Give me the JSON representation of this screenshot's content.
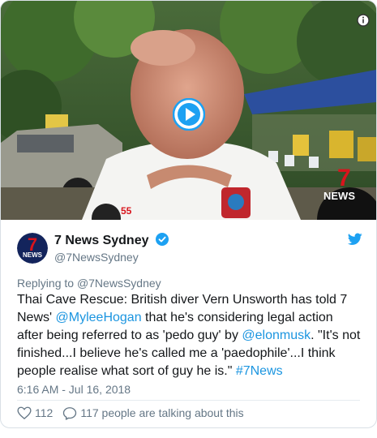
{
  "video": {
    "watermark_text": "NEWS",
    "shirt_text": "55",
    "badge_icon": "play-icon",
    "info_icon": "info-icon"
  },
  "account": {
    "display_name": "7 News Sydney",
    "handle": "@7NewsSydney",
    "avatar_text": "NEWS",
    "verified": true
  },
  "tweet": {
    "reply_prefix": "Replying to ",
    "reply_handle": "@7NewsSydney",
    "text_parts": [
      {
        "type": "text",
        "value": "Thai Cave Rescue: British diver Vern Unsworth has told 7 News' "
      },
      {
        "type": "link",
        "value": "@MyleeHogan"
      },
      {
        "type": "text",
        "value": " that he's considering legal action after being referred to as 'pedo guy' by "
      },
      {
        "type": "link",
        "value": "@elonmusk"
      },
      {
        "type": "text",
        "value": ". \"It's not finished...I believe he's called me a 'paedophile'...I think people realise what sort of guy he is.\" "
      },
      {
        "type": "link",
        "value": "#7News"
      }
    ],
    "timestamp": "6:16 AM - Jul 16, 2018",
    "likes": "112",
    "talking": "117 people are talking about this"
  },
  "colors": {
    "link": "#1b95e0",
    "muted": "#657786",
    "verified": "#1da1f2",
    "brand_red": "#d8141c",
    "avatar_bg": "#13245c"
  }
}
